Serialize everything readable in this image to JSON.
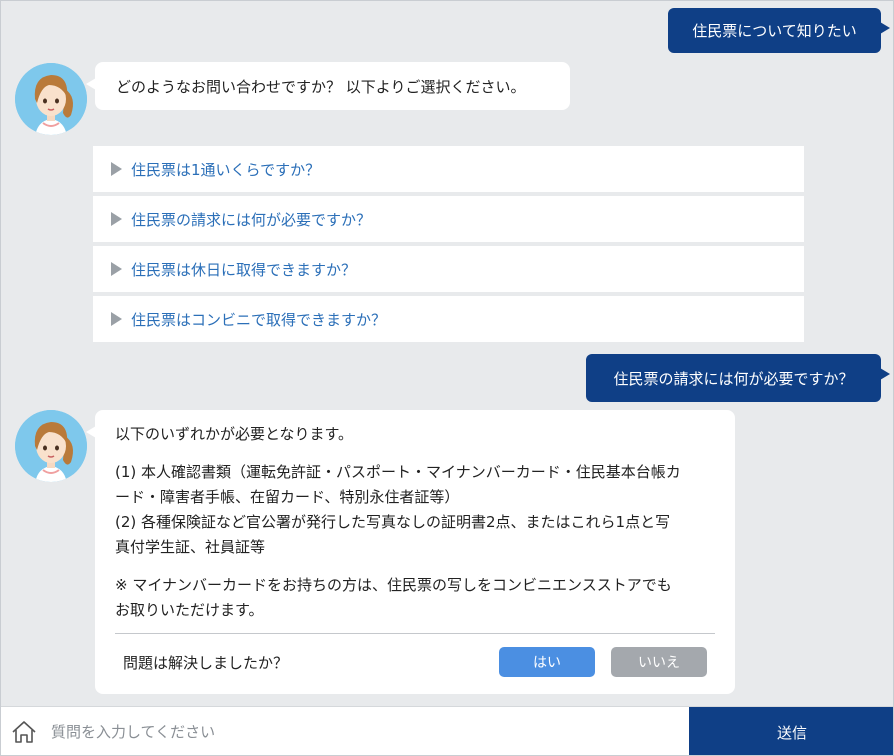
{
  "messages": {
    "user_1": "住民票について知りたい",
    "bot_1": "どのようなお問い合わせですか？ 以下よりご選択ください。",
    "choices": [
      "住民票は1通いくらですか？",
      "住民票の請求には何が必要ですか？",
      "住民票は休日に取得できますか？",
      "住民票はコンビニで取得できますか？"
    ],
    "user_2": "住民票の請求には何が必要ですか？",
    "answer": {
      "intro": "以下のいずれかが必要となります。",
      "item_1_line_1": "(1) 本人確認書類（運転免許証・パスポート・マイナンバーカード・住民基本台帳カ",
      "item_1_line_2": "ード・障害者手帳、在留カード、特別永住者証等）",
      "item_2_line_1": "(2) 各種保険証など官公署が発行した写真なしの証明書2点、またはこれら1点と写",
      "item_2_line_2": "真付学生証、社員証等",
      "note_line_1": "※ マイナンバーカードをお持ちの方は、住民票の写しをコンビニエンスストアでも",
      "note_line_2": "お取りいただけます。"
    },
    "feedback": {
      "question": "問題は解決しましたか？",
      "yes_label": "はい",
      "no_label": "いいえ"
    }
  },
  "input_bar": {
    "placeholder": "質問を入力してください",
    "send_label": "送信",
    "home_icon": "home-icon"
  },
  "colors": {
    "primary": "#0f3f86",
    "link": "#2b6fb8",
    "yes": "#4b8fe2",
    "no": "#a4a8ad",
    "background": "#e8eaec"
  }
}
